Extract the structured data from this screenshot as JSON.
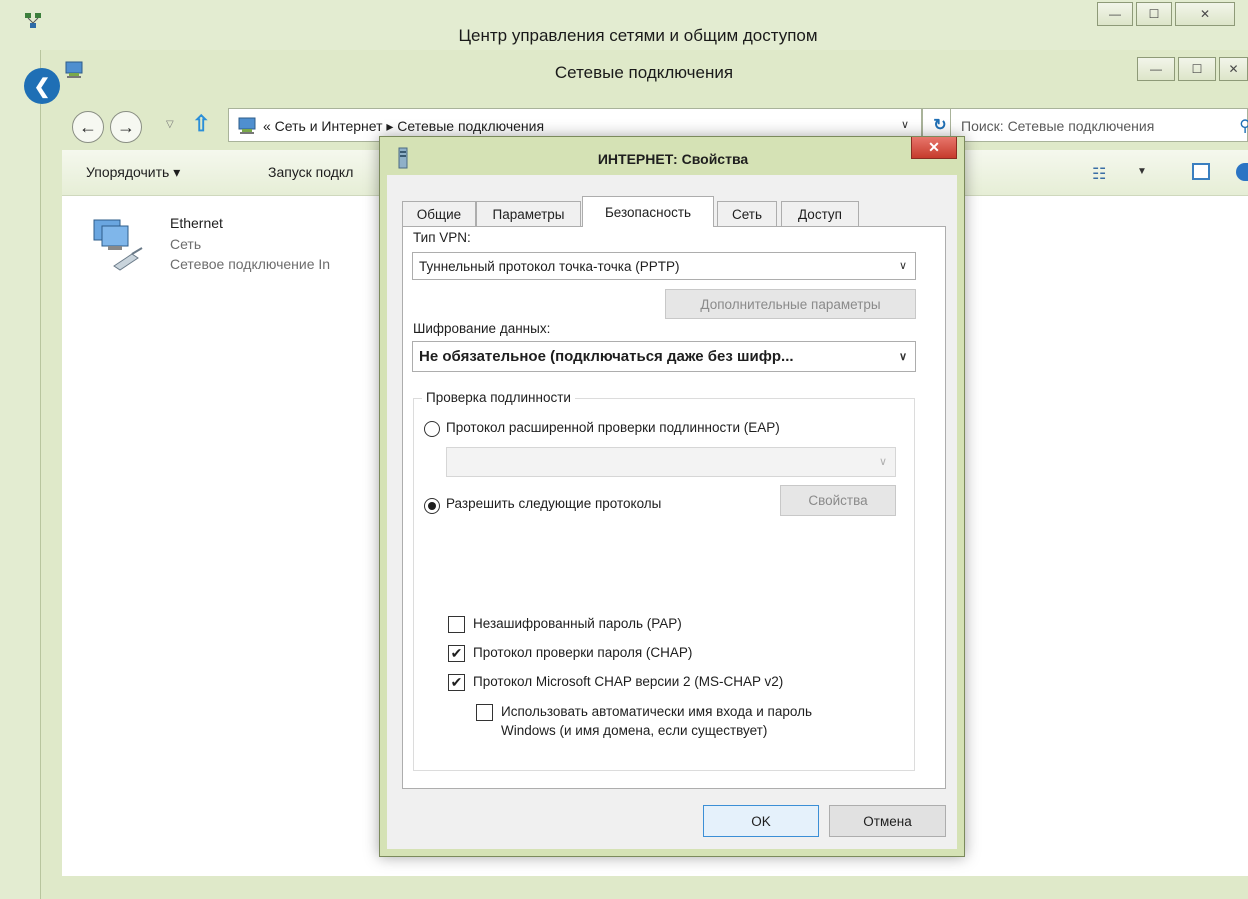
{
  "back_window": {
    "title": "Центр управления сетями и общим доступом",
    "min": "—",
    "max": "☐",
    "close": "✕"
  },
  "main_window": {
    "title": "Сетевые подключения",
    "back": "←",
    "forward": "→",
    "breadcrumb": "«  Сеть и Интернет  ▸  Сетевые подключения",
    "search_placeholder": "Поиск: Сетевые подключения",
    "toolbar": {
      "organize": "Упорядочить ▾",
      "start": "Запуск подкл"
    },
    "connection": {
      "name": "Ethernet",
      "network": "Сеть",
      "device": "Сетевое подключение In"
    }
  },
  "dialog": {
    "title": "ИНТЕРНЕТ: Свойства",
    "close": "✕",
    "tabs": [
      {
        "label": "Общие"
      },
      {
        "label": "Параметры"
      },
      {
        "label": "Безопасность"
      },
      {
        "label": "Сеть"
      },
      {
        "label": "Доступ"
      }
    ],
    "active_tab": "Безопасность",
    "vpn_type_label": "Тип VPN:",
    "vpn_type_value": "Туннельный протокол точка-точка (PPTP)",
    "advanced_button": "Дополнительные параметры",
    "encryption_label": "Шифрование данных:",
    "encryption_value": "Не обязательное (подключаться даже без шифр...",
    "auth_group": "Проверка подлинности",
    "eap_radio": "Протокол расширенной проверки подлинности (EAP)",
    "eap_selected": false,
    "eap_combo_value": "",
    "allow_radio": "Разрешить следующие протоколы",
    "allow_selected": true,
    "properties_button": "Свойства",
    "protocols": [
      {
        "label": "Незашифрованный пароль (PAP)",
        "checked": false
      },
      {
        "label": "Протокол проверки пароля (CHAP)",
        "checked": true
      },
      {
        "label": "Протокол Microsoft CHAP версии 2 (MS-CHAP v2)",
        "checked": true
      }
    ],
    "auto_logon_line1": "Использовать автоматически имя входа и пароль",
    "auto_logon_line2": "Windows (и имя домена, если существует)",
    "auto_logon_checked": false,
    "ok": "OK",
    "cancel": "Отмена"
  },
  "colors": {
    "window_frame": "#e3ecd1",
    "dialog_frame": "#d5e2b5",
    "accent_blue": "#1f6fb5",
    "close_red": "#c63b2c"
  }
}
